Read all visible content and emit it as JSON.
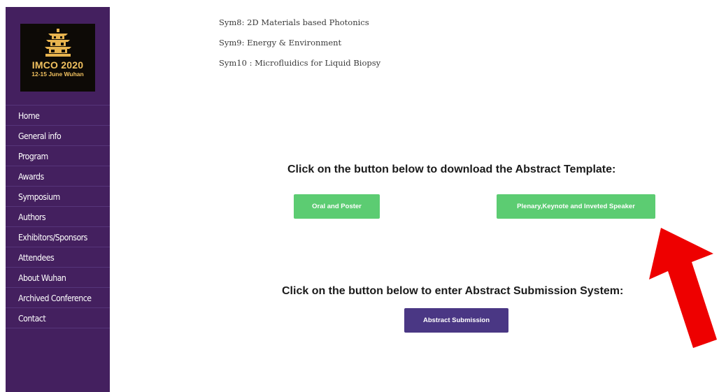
{
  "logo": {
    "title": "IMCO 2020",
    "date": "12-15 June  Wuhan",
    "icon": "pagoda-icon"
  },
  "nav": [
    {
      "label": "Home"
    },
    {
      "label": "General info"
    },
    {
      "label": "Program"
    },
    {
      "label": "Awards"
    },
    {
      "label": "Symposium"
    },
    {
      "label": "Authors"
    },
    {
      "label": "Exhibitors/Sponsors"
    },
    {
      "label": "Attendees"
    },
    {
      "label": "About Wuhan"
    },
    {
      "label": "Archived Conference"
    },
    {
      "label": "Contact"
    }
  ],
  "symposia": [
    "Sym8: 2D Materials based Photonics",
    "Sym9: Energy & Environment",
    "Sym10 : Microfluidics for Liquid Biopsy"
  ],
  "template_section": {
    "heading": "Click on the button below to download the Abstract Template:",
    "oral_poster_label": "Oral and Poster",
    "plenary_label": "Plenary,Keynote and Inveted Speaker"
  },
  "submission_section": {
    "heading": "Click on the button below to enter Abstract Submission System:",
    "submit_label": "Abstract Submission"
  },
  "colors": {
    "sidebar": "#44205f",
    "green_button": "#5ccc72",
    "purple_button": "#4a3784",
    "logo_gold": "#f1c15f",
    "annotation_arrow": "#ee0000"
  },
  "annotation": {
    "icon": "red-arrow-icon"
  }
}
